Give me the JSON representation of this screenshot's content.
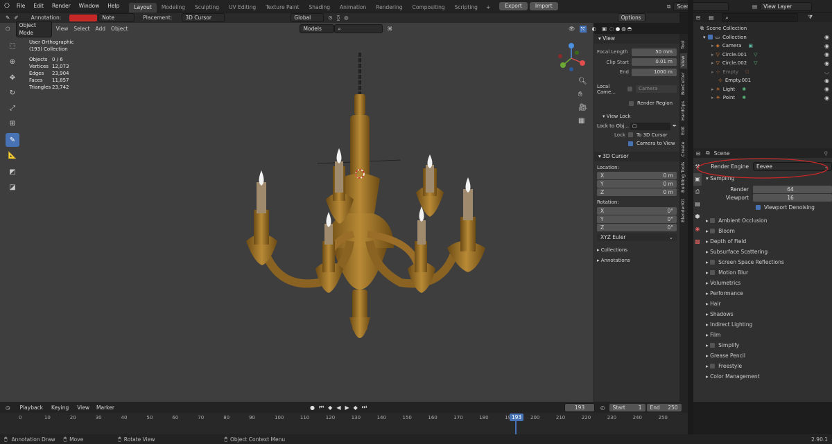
{
  "app": {
    "menus": [
      "File",
      "Edit",
      "Render",
      "Window",
      "Help"
    ],
    "workspaces": [
      "Layout",
      "Modeling",
      "Sculpting",
      "UV Editing",
      "Texture Paint",
      "Shading",
      "Animation",
      "Rendering",
      "Compositing",
      "Scripting"
    ],
    "export_label": "Export",
    "import_label": "Import",
    "scene": "Scene",
    "view_layer": "View Layer"
  },
  "tool_settings": {
    "annotation_label": "Annotation:",
    "annotation_color": "#c62828",
    "note": "Note",
    "placement_label": "Placement:",
    "placement": "3D Cursor",
    "transform": "Global",
    "options": "Options"
  },
  "header": {
    "mode": "Object Mode",
    "menus": [
      "View",
      "Select",
      "Add",
      "Object"
    ],
    "models": "Models"
  },
  "overlay": {
    "view": "User Orthographic",
    "collection": "(193) Collection",
    "stats": [
      {
        "k": "Objects",
        "v": "0 / 6"
      },
      {
        "k": "Vertices",
        "v": "12,073"
      },
      {
        "k": "Edges",
        "v": "23,904"
      },
      {
        "k": "Faces",
        "v": "11,857"
      },
      {
        "k": "Triangles",
        "v": "23,742"
      }
    ]
  },
  "npanel": {
    "view_title": "View",
    "focal_label": "Focal Length",
    "focal": "50 mm",
    "clip_start_label": "Clip Start",
    "clip_start": "0.01 m",
    "end_label": "End",
    "end": "1000 m",
    "local_camera_label": "Local Came...",
    "camera": "Camera",
    "render_region": "Render Region",
    "view_lock": "View Lock",
    "lock_to_obj": "Lock to Obj...",
    "lock_label": "Lock",
    "to_cursor": "To 3D Cursor",
    "camera_to_view": "Camera to View",
    "cursor_title": "3D Cursor",
    "location": "Location:",
    "loc": [
      {
        "axis": "X",
        "v": "0 m"
      },
      {
        "axis": "Y",
        "v": "0 m"
      },
      {
        "axis": "Z",
        "v": "0 m"
      }
    ],
    "rotation": "Rotation:",
    "rot": [
      {
        "axis": "X",
        "v": "0°"
      },
      {
        "axis": "Y",
        "v": "0°"
      },
      {
        "axis": "Z",
        "v": "0°"
      }
    ],
    "euler": "XYZ Euler",
    "collections": "Collections",
    "annotations": "Annotations"
  },
  "vtabs": [
    "Tool",
    "View",
    "BoxCutter",
    "HardOps",
    "Edit",
    "Create",
    "Building Tools",
    "BlenderKit"
  ],
  "outliner": {
    "root": "Scene Collection",
    "items": [
      "Collection",
      "Camera",
      "Circle.001",
      "Circle.002",
      "Empty",
      "Empty.001",
      "Light",
      "Point"
    ]
  },
  "props": {
    "scene": "Scene",
    "engine_label": "Render Engine",
    "engine": "Eevee",
    "sampling": "Sampling",
    "render_label": "Render",
    "render": "64",
    "viewport_label": "Viewport",
    "viewport": "16",
    "denoise": "Viewport Denoising",
    "sections": [
      "Ambient Occlusion",
      "Bloom",
      "Depth of Field",
      "Subsurface Scattering",
      "Screen Space Reflections",
      "Motion Blur",
      "Volumetrics",
      "Performance",
      "Hair",
      "Shadows",
      "Indirect Lighting",
      "Film",
      "Simplify",
      "Grease Pencil",
      "Freestyle",
      "Color Management"
    ]
  },
  "timeline": {
    "menus": [
      "Playback",
      "Keying",
      "View",
      "Marker"
    ],
    "frame": "193",
    "start_label": "Start",
    "start": "1",
    "end_label": "End",
    "end": "250",
    "ticks": [
      "0",
      "10",
      "20",
      "30",
      "40",
      "50",
      "60",
      "70",
      "80",
      "90",
      "100",
      "110",
      "120",
      "130",
      "140",
      "150",
      "160",
      "170",
      "180",
      "190",
      "200",
      "210",
      "220",
      "230",
      "240",
      "250"
    ]
  },
  "status": {
    "a": "Annotation Draw",
    "b": "Move",
    "c": "Rotate View",
    "d": "Object Context Menu",
    "version": "2.90.1"
  }
}
